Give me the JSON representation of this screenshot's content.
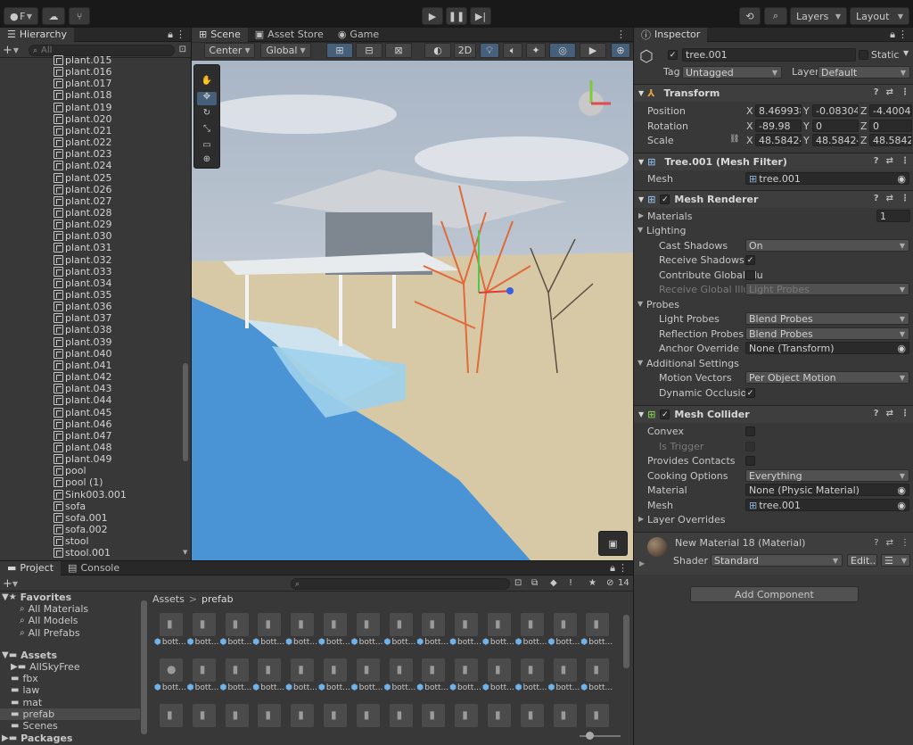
{
  "toolbar": {
    "account_label": "F",
    "play_icon": "play-icon",
    "layers_label": "Layers",
    "layout_label": "Layout"
  },
  "hierarchy": {
    "tab_label": "Hierarchy",
    "search_placeholder": "All",
    "items": [
      "plant.015",
      "plant.016",
      "plant.017",
      "plant.018",
      "plant.019",
      "plant.020",
      "plant.021",
      "plant.022",
      "plant.023",
      "plant.024",
      "plant.025",
      "plant.026",
      "plant.027",
      "plant.028",
      "plant.029",
      "plant.030",
      "plant.031",
      "plant.032",
      "plant.033",
      "plant.034",
      "plant.035",
      "plant.036",
      "plant.037",
      "plant.038",
      "plant.039",
      "plant.040",
      "plant.041",
      "plant.042",
      "plant.043",
      "plant.044",
      "plant.045",
      "plant.046",
      "plant.047",
      "plant.048",
      "plant.049",
      "pool",
      "pool (1)",
      "Sink003.001",
      "sofa",
      "sofa.001",
      "sofa.002",
      "stool",
      "stool.001"
    ]
  },
  "scene": {
    "tabs": [
      "Scene",
      "Asset Store",
      "Game"
    ],
    "pivot_label": "Center",
    "space_label": "Global",
    "mode_2d": "2D"
  },
  "inspector": {
    "tab_label": "Inspector",
    "object_name": "tree.001",
    "static_label": "Static",
    "tag_label": "Tag",
    "tag_value": "Untagged",
    "layer_label": "Layer",
    "layer_value": "Default",
    "transform": {
      "title": "Transform",
      "position_label": "Position",
      "rotation_label": "Rotation",
      "scale_label": "Scale",
      "position": {
        "x": "8.469938",
        "y": "-0.08304",
        "z": "-4.40040"
      },
      "rotation": {
        "x": "-89.98",
        "y": "0",
        "z": "0"
      },
      "scale": {
        "x": "48.58424",
        "y": "48.58424",
        "z": "48.58424"
      }
    },
    "mesh_filter": {
      "title": "Tree.001 (Mesh Filter)",
      "mesh_label": "Mesh",
      "mesh_value": "tree.001"
    },
    "mesh_renderer": {
      "title": "Mesh Renderer",
      "materials_label": "Materials",
      "materials_count": "1",
      "lighting_label": "Lighting",
      "cast_shadows_label": "Cast Shadows",
      "cast_shadows_value": "On",
      "receive_shadows_label": "Receive Shadows",
      "contribute_gi_label": "Contribute Global Illu",
      "receive_gi_label": "Receive Global Illumi",
      "receive_gi_value": "Light Probes",
      "probes_label": "Probes",
      "light_probes_label": "Light Probes",
      "light_probes_value": "Blend Probes",
      "reflection_probes_label": "Reflection Probes",
      "reflection_probes_value": "Blend Probes",
      "anchor_label": "Anchor Override",
      "anchor_value": "None (Transform)",
      "additional_label": "Additional Settings",
      "motion_vectors_label": "Motion Vectors",
      "motion_vectors_value": "Per Object Motion",
      "dynamic_occlusion_label": "Dynamic Occlusion"
    },
    "mesh_collider": {
      "title": "Mesh Collider",
      "convex_label": "Convex",
      "trigger_label": "Is Trigger",
      "contacts_label": "Provides Contacts",
      "cooking_label": "Cooking Options",
      "cooking_value": "Everything",
      "material_label": "Material",
      "material_value": "None (Physic Material)",
      "mesh_label": "Mesh",
      "mesh_value": "tree.001",
      "overrides_label": "Layer Overrides"
    },
    "material": {
      "title": "New Material 18 (Material)",
      "shader_label": "Shader",
      "shader_value": "Standard",
      "edit_label": "Edit..."
    },
    "add_component": "Add Component"
  },
  "project": {
    "tabs": [
      "Project",
      "Console"
    ],
    "count": "14",
    "tree": {
      "favorites": "Favorites",
      "fav_items": [
        "All Materials",
        "All Models",
        "All Prefabs"
      ],
      "assets": "Assets",
      "asset_items": [
        "AllSkyFree",
        "fbx",
        "law",
        "mat",
        "prefab",
        "Scenes"
      ],
      "packages": "Packages"
    },
    "breadcrumb": [
      "Assets",
      "prefab"
    ],
    "asset_label": "bott..."
  },
  "colors": {
    "accent": "#46607c",
    "bg": "#383838",
    "header": "#282828"
  }
}
